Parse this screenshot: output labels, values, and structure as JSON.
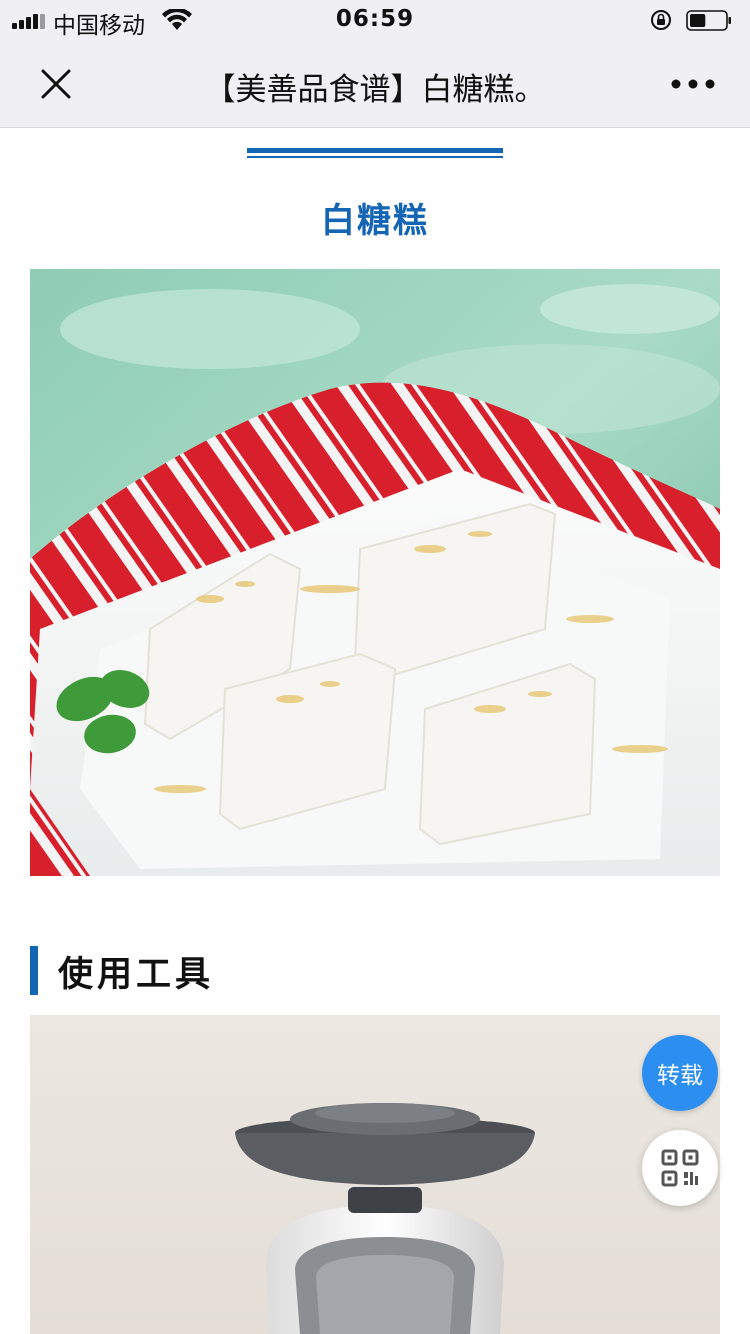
{
  "status_bar": {
    "carrier": "中国移动",
    "time": "06:59",
    "battery_level": 0.45
  },
  "nav": {
    "title": "【美善品食谱】白糖糕。",
    "close_icon": "close-icon",
    "more_icon": "more-dots-icon"
  },
  "article": {
    "recipe_title": "白糖糕",
    "hero_image": "white sugar cake pieces on white plate with red striped cloth and mint",
    "section_title": "使用工具",
    "tool_image": "thermomix kitchen machine"
  },
  "floating": {
    "repost_label": "转载",
    "qr_icon": "qr-code-icon"
  },
  "colors": {
    "accent": "#1565b5",
    "repost_bg": "#2b8ef0",
    "bar_bg": "#efeff4"
  }
}
